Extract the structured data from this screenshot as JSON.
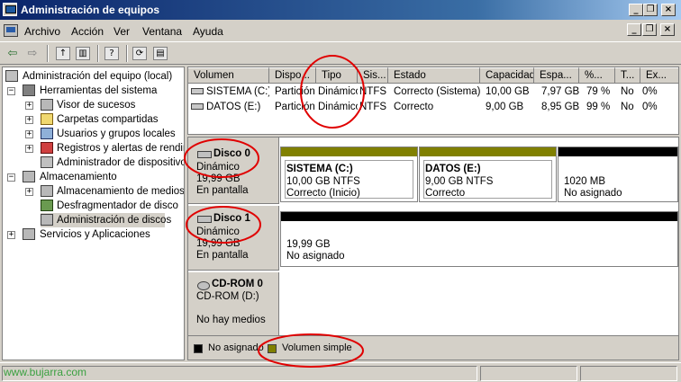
{
  "window": {
    "title": "Administración de equipos",
    "minimize": "_",
    "restore": "❐",
    "close": "×"
  },
  "menu": [
    "Archivo",
    "Acción",
    "Ver",
    "Ventana",
    "Ayuda"
  ],
  "toolbar": {
    "back": "⇦",
    "forward": "⇨",
    "help": "?"
  },
  "tree": {
    "root": "Administración del equipo (local)",
    "items": [
      "Herramientas del sistema",
      "Visor de sucesos",
      "Carpetas compartidas",
      "Usuarios y grupos locales",
      "Registros y alertas de rendim",
      "Administrador de dispositivos",
      "Almacenamiento",
      "Almacenamiento de medios ex",
      "Desfragmentador de disco",
      "Administración de discos",
      "Servicios y Aplicaciones"
    ]
  },
  "volumes": {
    "columns": [
      "Volumen",
      "Dispo...",
      "Tipo",
      "Sis...",
      "Estado",
      "Capacidad",
      "Espa...",
      "%...",
      "T...",
      "Ex..."
    ],
    "rows": [
      [
        "SISTEMA (C:)",
        "Partición",
        "Dinámico",
        "NTFS",
        "Correcto (Sistema)",
        "10,00 GB",
        "7,97 GB",
        "79 %",
        "No",
        "0%"
      ],
      [
        "DATOS (E:)",
        "Partición",
        "Dinámico",
        "NTFS",
        "Correcto",
        "9,00 GB",
        "8,95 GB",
        "99 %",
        "No",
        "0%"
      ]
    ]
  },
  "disks": [
    {
      "name": "Disco 0",
      "type": "Dinámico",
      "size": "19,99 GB",
      "state": "En pantalla",
      "partitions": [
        {
          "name": "SISTEMA  (C:)",
          "size": "10,00 GB NTFS",
          "status": "Correcto (Inicio)",
          "color": "#808000"
        },
        {
          "name": "DATOS  (E:)",
          "size": "9,00 GB NTFS",
          "status": "Correcto",
          "color": "#808000"
        },
        {
          "name": "",
          "size": "1020 MB",
          "status": "No asignado",
          "color": "#000000"
        }
      ]
    },
    {
      "name": "Disco 1",
      "type": "Dinámico",
      "size": "19,99 GB",
      "state": "En pantalla",
      "partitions": [
        {
          "name": "",
          "size": "19,99 GB",
          "status": "No asignado",
          "color": "#000000"
        }
      ]
    },
    {
      "name": "CD-ROM 0",
      "type": "CD-ROM (D:)",
      "size": "",
      "state": "No hay medios"
    }
  ],
  "legend": [
    {
      "label": "No asignado",
      "color": "#000000"
    },
    {
      "label": "Volumen simple",
      "color": "#808000"
    }
  ],
  "watermark": "www.bujarra.com",
  "annotation_color": "#e00000"
}
